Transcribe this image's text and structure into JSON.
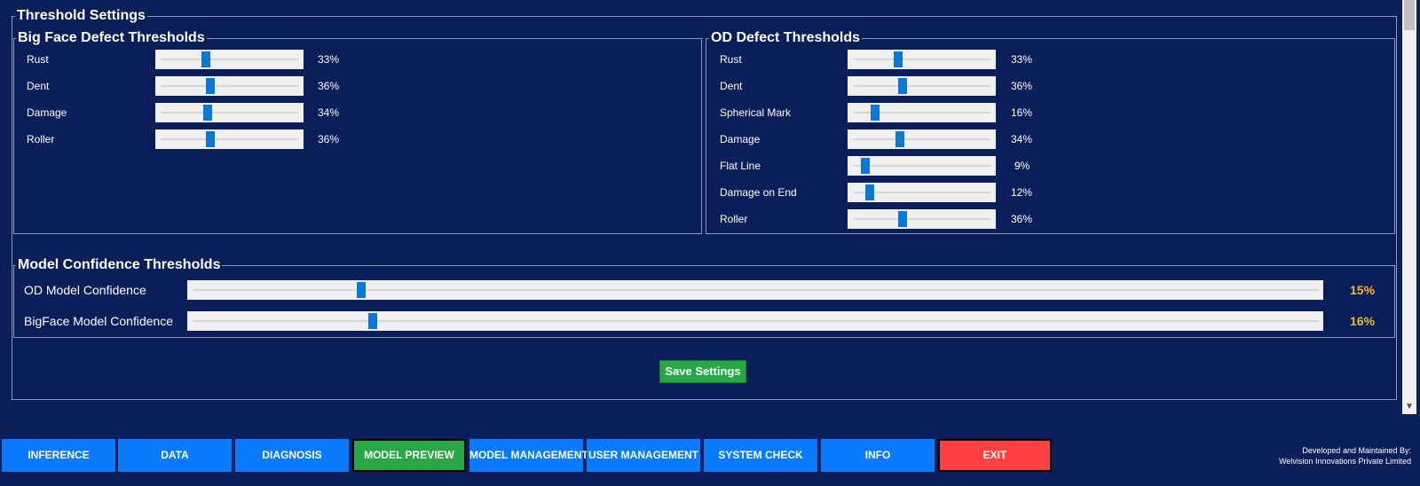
{
  "threshold_settings": {
    "title": "Threshold Settings",
    "big_face": {
      "title": "Big Face Defect Thresholds",
      "items": [
        {
          "label": "Rust",
          "value": 33,
          "display": "33%"
        },
        {
          "label": "Dent",
          "value": 36,
          "display": "36%"
        },
        {
          "label": "Damage",
          "value": 34,
          "display": "34%"
        },
        {
          "label": "Roller",
          "value": 36,
          "display": "36%"
        }
      ]
    },
    "od": {
      "title": "OD Defect Thresholds",
      "items": [
        {
          "label": "Rust",
          "value": 33,
          "display": "33%"
        },
        {
          "label": "Dent",
          "value": 36,
          "display": "36%"
        },
        {
          "label": "Spherical Mark",
          "value": 16,
          "display": "16%"
        },
        {
          "label": "Damage",
          "value": 34,
          "display": "34%"
        },
        {
          "label": "Flat Line",
          "value": 9,
          "display": "9%"
        },
        {
          "label": "Damage on End",
          "value": 12,
          "display": "12%"
        },
        {
          "label": "Roller",
          "value": 36,
          "display": "36%"
        }
      ]
    },
    "model_confidence": {
      "title": "Model Confidence Thresholds",
      "items": [
        {
          "label": "OD Model Confidence",
          "value": 15,
          "display": "15%"
        },
        {
          "label": "BigFace Model Confidence",
          "value": 16,
          "display": "16%"
        }
      ]
    },
    "save_label": "Save Settings"
  },
  "nav": {
    "buttons": [
      {
        "label": "INFERENCE"
      },
      {
        "label": "DATA"
      },
      {
        "label": "DIAGNOSIS"
      },
      {
        "label": "MODEL PREVIEW"
      },
      {
        "label": "MODEL MANAGEMENT"
      },
      {
        "label": "USER MANAGEMENT"
      },
      {
        "label": "SYSTEM CHECK"
      },
      {
        "label": "INFO"
      },
      {
        "label": "EXIT"
      }
    ],
    "active": "MODEL PREVIEW"
  },
  "footer": {
    "line1": "Developed and Maintained By:",
    "line2": "Welvision Innovations Private Limited"
  },
  "colors": {
    "background": "#0a1e5a",
    "accent_blue": "#0a7aff",
    "active_green": "#28a745",
    "exit_red": "#ff4040",
    "confidence_value": "#f5b72b"
  }
}
